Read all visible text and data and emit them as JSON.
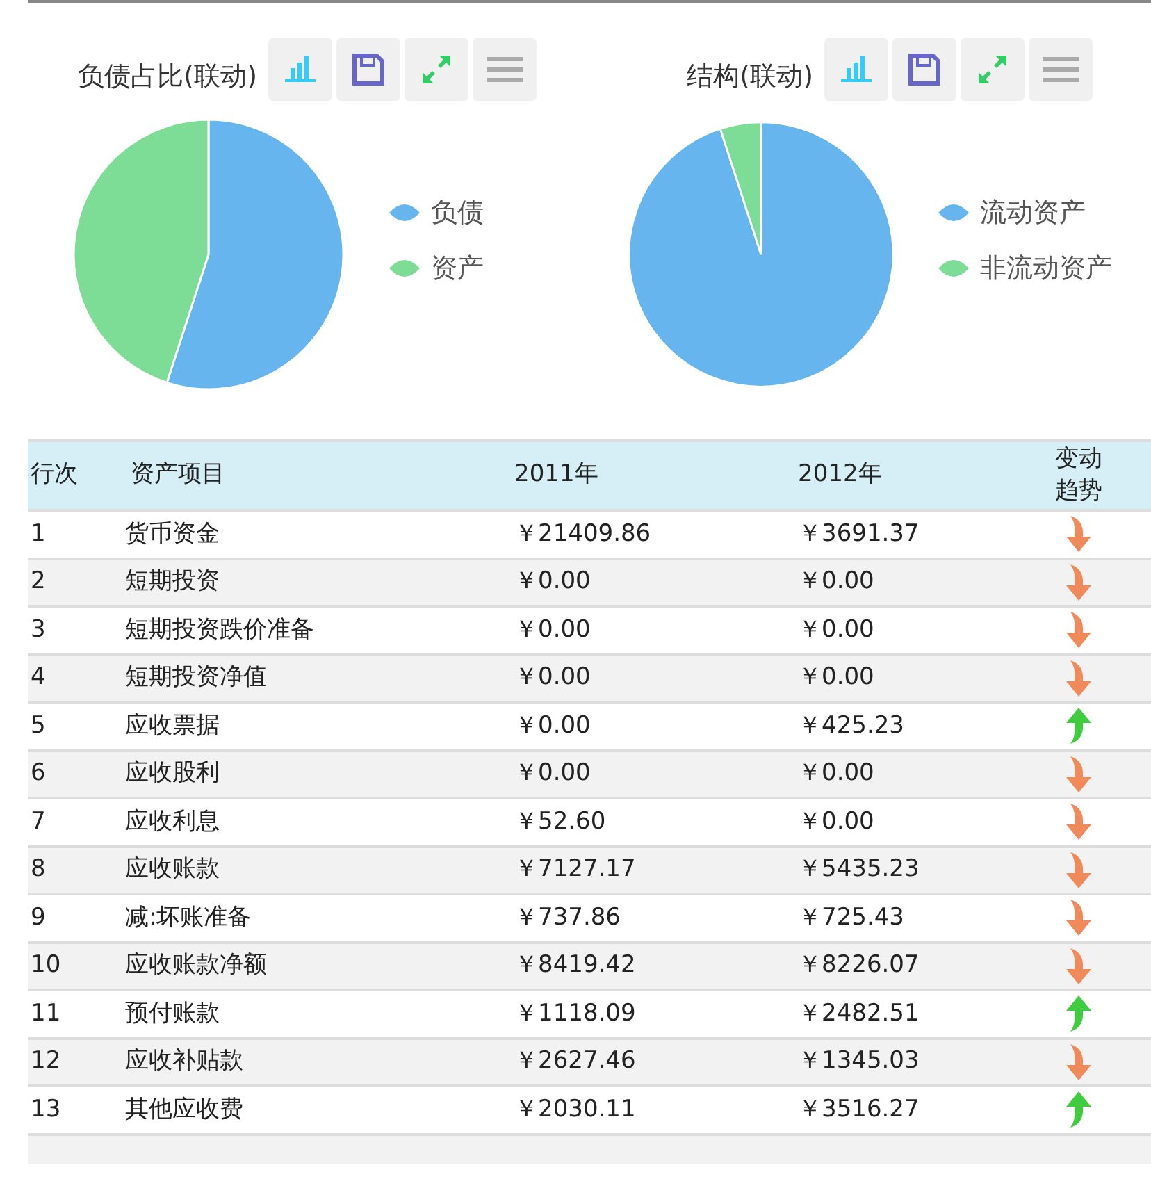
{
  "charts": [
    {
      "title": "负债占比(联动)",
      "legend": [
        {
          "label": "负债",
          "color": "#66b5ee"
        },
        {
          "label": "资产",
          "color": "#7ddc96"
        }
      ]
    },
    {
      "title": "结构(联动)",
      "legend": [
        {
          "label": "流动资产",
          "color": "#66b5ee"
        },
        {
          "label": "非流动资产",
          "color": "#7ddc96"
        }
      ]
    }
  ],
  "table": {
    "columns": [
      "行次",
      "资产项目",
      "2011年",
      "2012年",
      "变动趋势"
    ],
    "rows": [
      {
        "no": "1",
        "item": "货币资金",
        "y2011": "￥21409.86",
        "y2012": "￥3691.37",
        "kind": "down"
      },
      {
        "no": "2",
        "item": "短期投资",
        "y2011": "￥0.00",
        "y2012": "￥0.00",
        "kind": "down"
      },
      {
        "no": "3",
        "item": "短期投资跌价准备",
        "y2011": "￥0.00",
        "y2012": "￥0.00",
        "kind": "down"
      },
      {
        "no": "4",
        "item": "短期投资净值",
        "y2011": "￥0.00",
        "y2012": "￥0.00",
        "kind": "down"
      },
      {
        "no": "5",
        "item": "应收票据",
        "y2011": "￥0.00",
        "y2012": "￥425.23",
        "kind": "up"
      },
      {
        "no": "6",
        "item": "应收股利",
        "y2011": "￥0.00",
        "y2012": "￥0.00",
        "kind": "down"
      },
      {
        "no": "7",
        "item": "应收利息",
        "y2011": "￥52.60",
        "y2012": "￥0.00",
        "kind": "down"
      },
      {
        "no": "8",
        "item": "应收账款",
        "y2011": "￥7127.17",
        "y2012": "￥5435.23",
        "kind": "down"
      },
      {
        "no": "9",
        "item": "减:坏账准备",
        "y2011": "￥737.86",
        "y2012": "￥725.43",
        "kind": "down"
      },
      {
        "no": "10",
        "item": "应收账款净额",
        "y2011": "￥8419.42",
        "y2012": "￥8226.07",
        "kind": "down"
      },
      {
        "no": "11",
        "item": "预付账款",
        "y2011": "￥1118.09",
        "y2012": "￥2482.51",
        "kind": "up"
      },
      {
        "no": "12",
        "item": "应收补贴款",
        "y2011": "￥2627.46",
        "y2012": "￥1345.03",
        "kind": "down"
      },
      {
        "no": "13",
        "item": "其他应收费",
        "y2011": "￥2030.11",
        "y2012": "￥3516.27",
        "kind": "up"
      }
    ]
  }
}
